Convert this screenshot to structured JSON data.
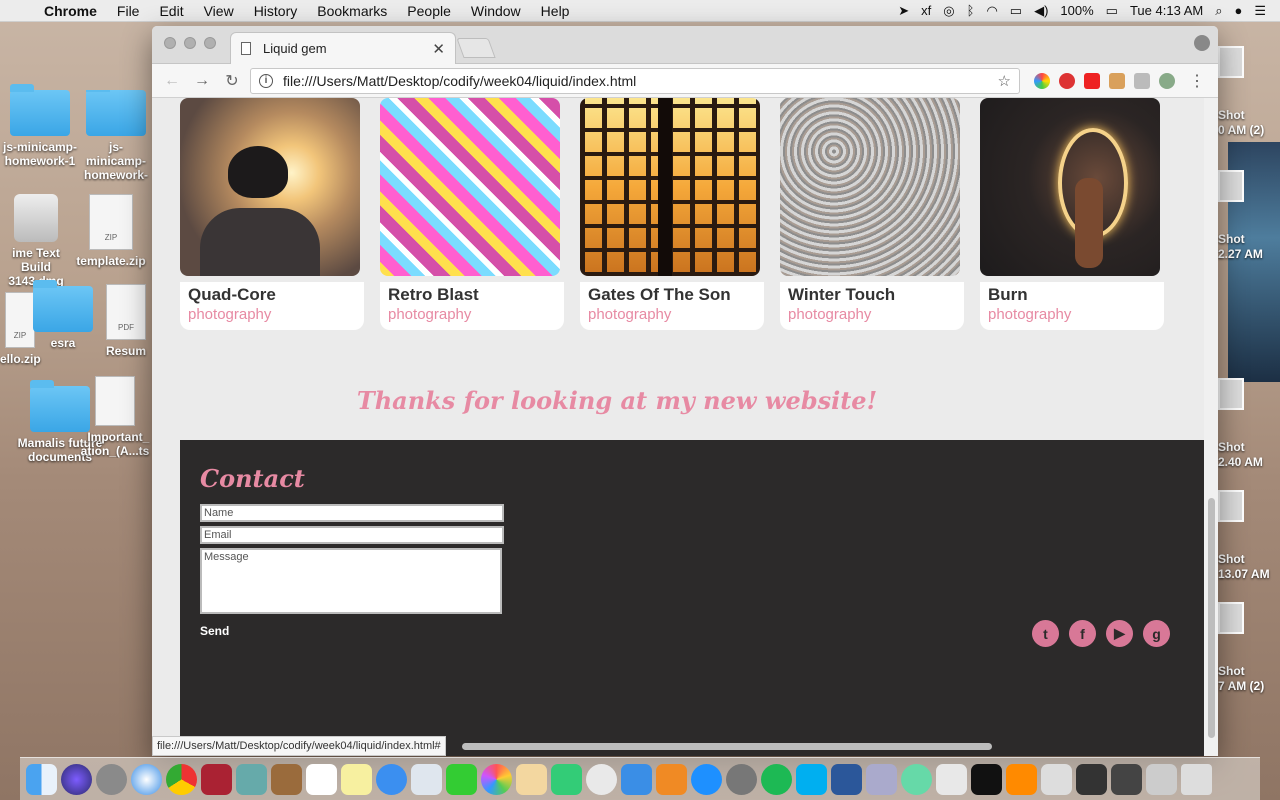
{
  "menubar": {
    "app": "Chrome",
    "items": [
      "File",
      "Edit",
      "View",
      "History",
      "Bookmarks",
      "People",
      "Window",
      "Help"
    ],
    "battery": "100%",
    "clock": "Tue 4:13 AM"
  },
  "desktop_left": [
    {
      "label": "js-minicamp-homework-1",
      "kind": "folder"
    },
    {
      "label": "js-minicamp-homework-",
      "kind": "folder"
    },
    {
      "label": "ime Text Build 3143.dmg",
      "kind": "disk"
    },
    {
      "label": "template.zip",
      "kind": "zip"
    },
    {
      "label": "ello.zip",
      "kind": "zip"
    },
    {
      "label": "esra",
      "kind": "folder"
    },
    {
      "label": "Resum",
      "kind": "pdf"
    },
    {
      "label": "Mamalis future documents",
      "kind": "folder"
    },
    {
      "label": "_Important_ ation_(A...ts",
      "kind": "doc"
    }
  ],
  "desktop_right": [
    {
      "l1": "Shot",
      "l2": "0 AM (2)"
    },
    {
      "l1": "Shot",
      "l2": "2.27 AM"
    },
    {
      "l1": "Shot",
      "l2": "2.40 AM"
    },
    {
      "l1": "Shot",
      "l2": "13.07 AM"
    },
    {
      "l1": "Shot",
      "l2": "7 AM (2)"
    }
  ],
  "browser": {
    "tab_title": "Liquid gem",
    "url": "file:///Users/Matt/Desktop/codify/week04/liquid/index.html",
    "status_url": "file:///Users/Matt/Desktop/codify/week04/liquid/index.html#"
  },
  "portfolio": [
    {
      "name": "Quad-Core",
      "category": "photography"
    },
    {
      "name": "Retro Blast",
      "category": "photography"
    },
    {
      "name": "Gates Of The Son",
      "category": "photography"
    },
    {
      "name": "Winter Touch",
      "category": "photography"
    },
    {
      "name": "Burn",
      "category": "photography"
    }
  ],
  "thanks": "Thanks for looking at my new website!",
  "contact": {
    "title": "Contact",
    "name_placeholder": "Name",
    "email_placeholder": "Email",
    "message_placeholder": "Message",
    "send": "Send"
  },
  "socials": [
    "twitter-icon",
    "facebook-icon",
    "youtube-icon",
    "googleplus-icon"
  ],
  "colors": {
    "accent": "#e78aa3",
    "footer_bg": "#2c2a2a",
    "page_bg": "#ebebeb"
  }
}
